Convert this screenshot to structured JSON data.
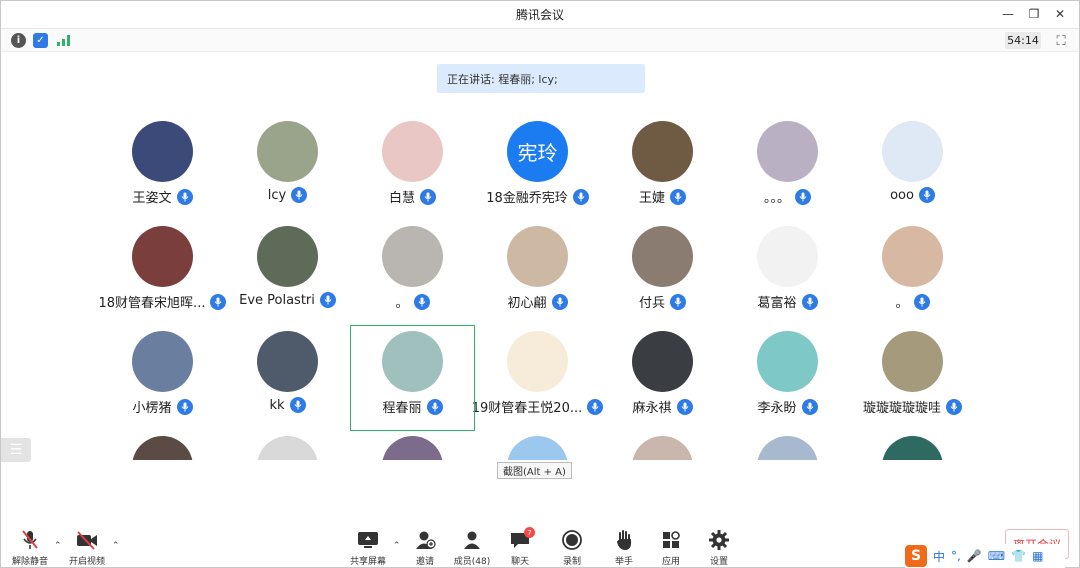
{
  "window": {
    "title": "腾讯会议"
  },
  "infobar": {
    "timer": "54:14"
  },
  "speaking": {
    "text": "正在讲话: 程春丽; lcy;"
  },
  "participants": [
    {
      "name": "王姿文",
      "avatar_color": "#3c4a7a",
      "avatar_text": ""
    },
    {
      "name": "lcy",
      "avatar_color": "#9aa48a",
      "avatar_text": ""
    },
    {
      "name": "白慧",
      "avatar_color": "#e9c7c5",
      "avatar_text": ""
    },
    {
      "name": "18金融乔宪玲",
      "avatar_color": "#1a7cf0",
      "avatar_text": "宪玲"
    },
    {
      "name": "王婕",
      "avatar_color": "#6f5a44",
      "avatar_text": ""
    },
    {
      "name": "。。。",
      "avatar_color": "#b9b1c3",
      "avatar_text": ""
    },
    {
      "name": "ooo",
      "avatar_color": "#dfe9f6",
      "avatar_text": ""
    },
    {
      "name": "18财管春宋旭晖...",
      "avatar_color": "#7a3f3d",
      "avatar_text": ""
    },
    {
      "name": "Eve Polastri",
      "avatar_color": "#5d6b58",
      "avatar_text": ""
    },
    {
      "name": "。",
      "avatar_color": "#b9b5b0",
      "avatar_text": ""
    },
    {
      "name": "初心翩",
      "avatar_color": "#cdb9a3",
      "avatar_text": ""
    },
    {
      "name": "付兵",
      "avatar_color": "#8a7c70",
      "avatar_text": ""
    },
    {
      "name": "葛富裕",
      "avatar_color": "#f2f2f2",
      "avatar_text": ""
    },
    {
      "name": "。",
      "avatar_color": "#d7b8a3",
      "avatar_text": ""
    },
    {
      "name": "小楞猪",
      "avatar_color": "#6a7fa0",
      "avatar_text": ""
    },
    {
      "name": "kk",
      "avatar_color": "#4f5b6a",
      "avatar_text": ""
    },
    {
      "name": "程春丽",
      "avatar_color": "#9fc0bd",
      "avatar_text": ""
    },
    {
      "name": "19财管春王悦20...",
      "avatar_color": "#f6ecd9",
      "avatar_text": ""
    },
    {
      "name": "麻永祺",
      "avatar_color": "#3a3d42",
      "avatar_text": ""
    },
    {
      "name": "李永盼",
      "avatar_color": "#7fc8c8",
      "avatar_text": ""
    },
    {
      "name": "璇璇璇璇璇哇",
      "avatar_color": "#a59a7c",
      "avatar_text": ""
    },
    {
      "name": "",
      "avatar_color": "#5a4c45",
      "avatar_text": ""
    },
    {
      "name": "",
      "avatar_color": "#d9d9d9",
      "avatar_text": ""
    },
    {
      "name": "",
      "avatar_color": "#7d6b8c",
      "avatar_text": ""
    },
    {
      "name": "",
      "avatar_color": "#9cc8f0",
      "avatar_text": ""
    },
    {
      "name": "",
      "avatar_color": "#c9b7ae",
      "avatar_text": ""
    },
    {
      "name": "",
      "avatar_color": "#a7b9cf",
      "avatar_text": ""
    },
    {
      "name": "",
      "avatar_color": "#2f6a62",
      "avatar_text": ""
    }
  ],
  "tooltip": {
    "text": "截图(Alt + A)"
  },
  "toolbar": {
    "unmute": "解除静音",
    "start_video": "开启视频",
    "share_screen": "共享屏幕",
    "invite": "邀请",
    "members": "成员(48)",
    "chat": "聊天",
    "chat_badge": "7",
    "record": "录制",
    "raise_hand": "举手",
    "apps": "应用",
    "settings": "设置",
    "leave": "离开会议"
  },
  "ime": {
    "lang": "中"
  },
  "colors": {
    "accent": "#2f7be6",
    "highlight_border": "#2fb26a",
    "leave": "#e14040"
  }
}
